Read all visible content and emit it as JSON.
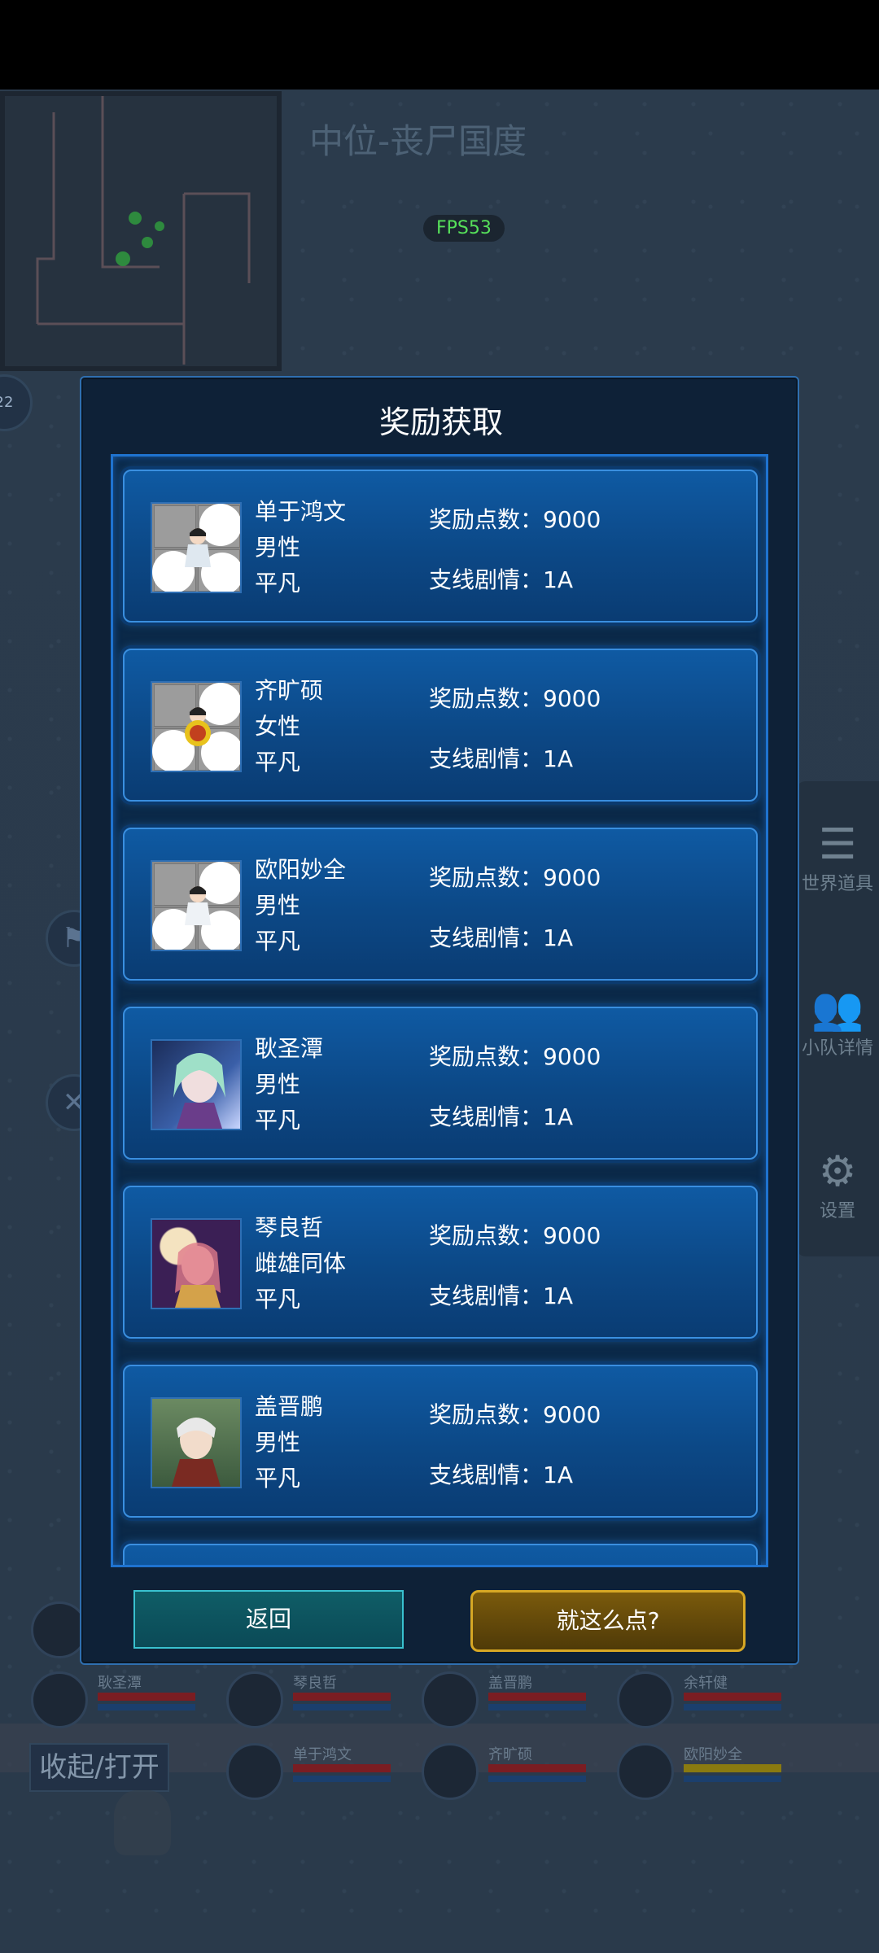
{
  "map": {
    "title": "中位-丧尸国度",
    "fps": "FPS53",
    "level_badge": "22"
  },
  "side_menu": {
    "items": [
      {
        "label": "世界道具",
        "icon": "layers-icon"
      },
      {
        "label": "小队详情",
        "icon": "team-icon"
      },
      {
        "label": "设置",
        "icon": "gear-icon"
      }
    ]
  },
  "modal": {
    "title": "奖励获取",
    "points_label": "奖励点数：",
    "branch_label": "支线剧情：",
    "cards": [
      {
        "name": "单于鸿文",
        "gender": "男性",
        "rank": "平凡",
        "points": "9000",
        "branch": "1A",
        "avatar": "grid"
      },
      {
        "name": "齐旷硕",
        "gender": "女性",
        "rank": "平凡",
        "points": "9000",
        "branch": "1A",
        "avatar": "grid"
      },
      {
        "name": "欧阳妙全",
        "gender": "男性",
        "rank": "平凡",
        "points": "9000",
        "branch": "1A",
        "avatar": "grid"
      },
      {
        "name": "耿圣潭",
        "gender": "男性",
        "rank": "平凡",
        "points": "9000",
        "branch": "1A",
        "avatar": "anime1"
      },
      {
        "name": "琴良哲",
        "gender": "雌雄同体",
        "rank": "平凡",
        "points": "9000",
        "branch": "1A",
        "avatar": "anime2"
      },
      {
        "name": "盖晋鹏",
        "gender": "男性",
        "rank": "平凡",
        "points": "9000",
        "branch": "1A",
        "avatar": "anime3"
      }
    ],
    "back_label": "返回",
    "confirm_label": "就这么点?"
  },
  "team": {
    "fold_label": "收起/打开",
    "members": [
      {
        "name": "耿圣潭"
      },
      {
        "name": "琴良哲"
      },
      {
        "name": "盖晋鹏"
      },
      {
        "name": "余轩健"
      },
      {
        "name": "单于鸿文"
      },
      {
        "name": "齐旷硕"
      },
      {
        "name": "欧阳妙全"
      }
    ]
  }
}
